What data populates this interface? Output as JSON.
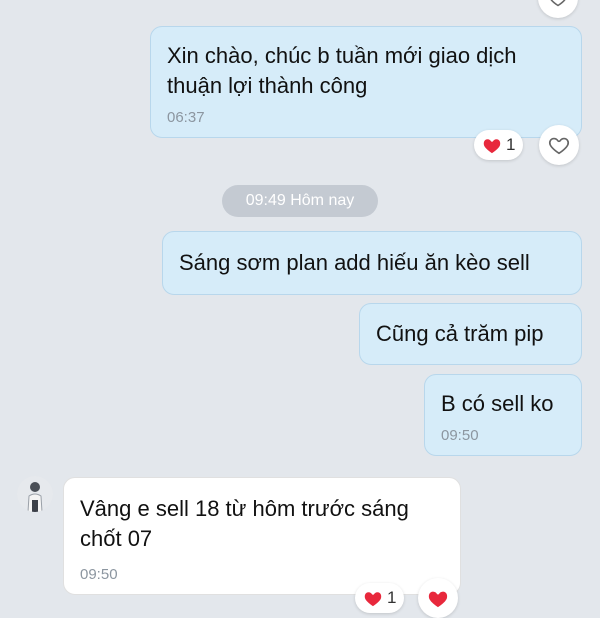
{
  "messages": [
    {
      "text_line1": "Xin chào, chúc b tuần mới giao dịch",
      "text_line2": "thuận lợi thành công",
      "time": "06:37",
      "reaction_count": "1"
    },
    {
      "text": "Sáng sơm plan add hiếu ăn kèo sell"
    },
    {
      "text": "Cũng cả trăm pip"
    },
    {
      "text": "B có sell ko",
      "time": "09:50"
    },
    {
      "text_line1": "Vâng e sell 18 từ hôm trước sáng",
      "text_line2": "chốt 07",
      "time": "09:50",
      "reaction_count": "1"
    }
  ],
  "date_separator": "09:49 Hôm nay",
  "icons": {
    "heart_filled": "heart-filled-icon",
    "heart_outline": "heart-outline-icon",
    "avatar": "contact-avatar"
  },
  "colors": {
    "outgoing_bubble": "#d6ecf9",
    "incoming_bubble": "#ffffff",
    "background": "#e3e7ec",
    "heart": "#e8283c"
  }
}
